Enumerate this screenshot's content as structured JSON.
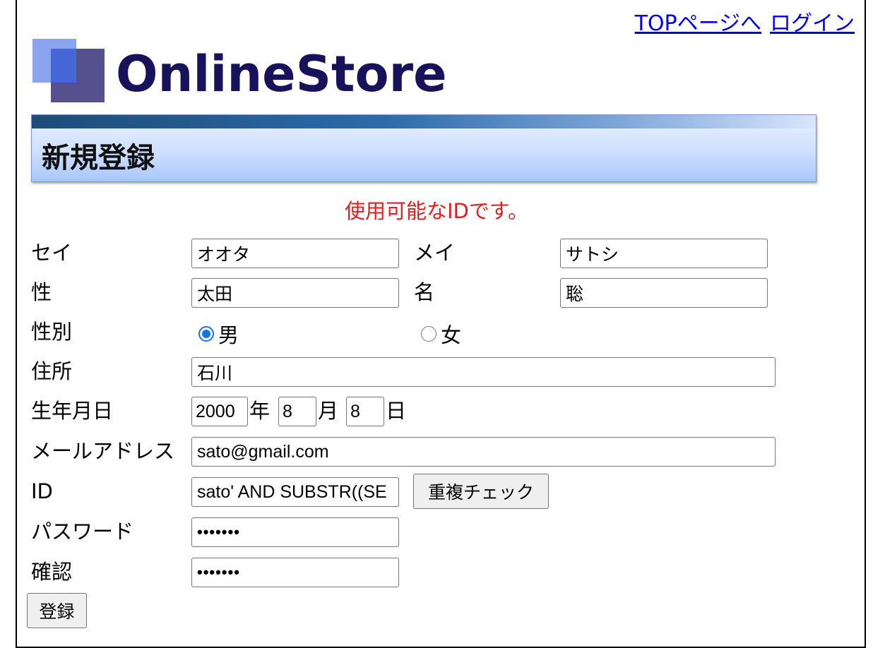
{
  "top_links": {
    "top_page": "TOPページへ",
    "login": "ログイン"
  },
  "logo": {
    "text": "OnlineStore"
  },
  "header": {
    "title": "新規登録"
  },
  "message": "使用可能なIDです。",
  "form": {
    "sei_label": "セイ",
    "sei_value": "オオタ",
    "mei_label": "メイ",
    "mei_value": "サトシ",
    "last_name_label": "性",
    "last_name_value": "太田",
    "first_name_label": "名",
    "first_name_value": "聡",
    "gender_label": "性別",
    "gender_male": "男",
    "gender_female": "女",
    "gender_selected": "男",
    "address_label": "住所",
    "address_value": "石川",
    "birthday_label": "生年月日",
    "birth_year": "2000",
    "year_unit": "年",
    "birth_month": "8",
    "month_unit": "月",
    "birth_day": "8",
    "day_unit": "日",
    "email_label": "メールアドレス",
    "email_value": "sato@gmail.com",
    "id_label": "ID",
    "id_value": "sato' AND SUBSTR((SE",
    "duplicate_check_label": "重複チェック",
    "password_label": "パスワード",
    "password_value": "•••••••",
    "confirm_label": "確認",
    "confirm_value": "•••••••",
    "submit_label": "登録"
  },
  "colors": {
    "message": "#e02020",
    "link": "#0000ee",
    "logo_text": "#18125a",
    "radio_accent": "#1a73e8"
  }
}
